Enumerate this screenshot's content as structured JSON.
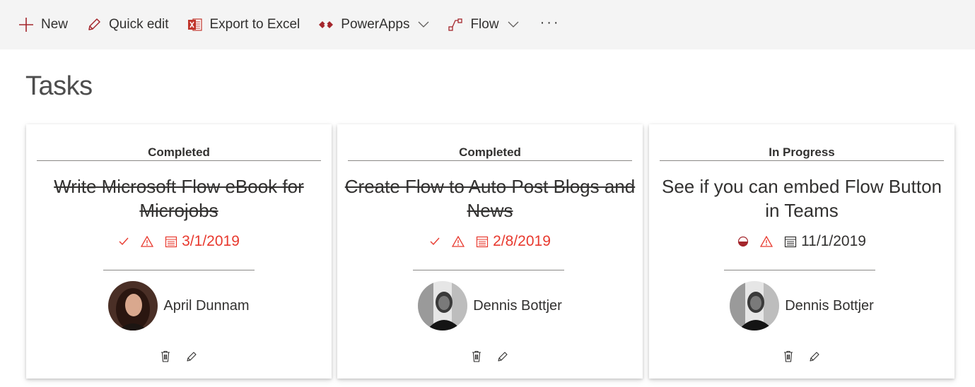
{
  "toolbar": {
    "new_label": "New",
    "quick_edit_label": "Quick edit",
    "export_label": "Export to Excel",
    "powerapps_label": "PowerApps",
    "flow_label": "Flow",
    "more_label": "···"
  },
  "page": {
    "title": "Tasks"
  },
  "cards": [
    {
      "status": "Completed",
      "title": "Write Microsoft Flow eBook for Microjobs",
      "date": "3/1/2019",
      "assignee": "April Dunnam"
    },
    {
      "status": "Completed",
      "title": "Create Flow to Auto Post Blogs and News",
      "date": "2/8/2019",
      "assignee": "Dennis Bottjer"
    },
    {
      "status": "In Progress",
      "title": "See if you can embed Flow Button in Teams",
      "date": "11/1/2019",
      "assignee": "Dennis Bottjer"
    }
  ],
  "colors": {
    "overdue": "#e8392e",
    "text": "#323130",
    "excel": "#c0352b",
    "powerapps": "#a4262c"
  },
  "icons": [
    "plus-icon",
    "pencil-icon",
    "excel-icon",
    "powerapps-icon",
    "flow-icon",
    "chevron-down-icon",
    "checkmark-icon",
    "warning-icon",
    "calendar-icon",
    "half-circle-icon",
    "trash-icon",
    "edit-icon"
  ]
}
